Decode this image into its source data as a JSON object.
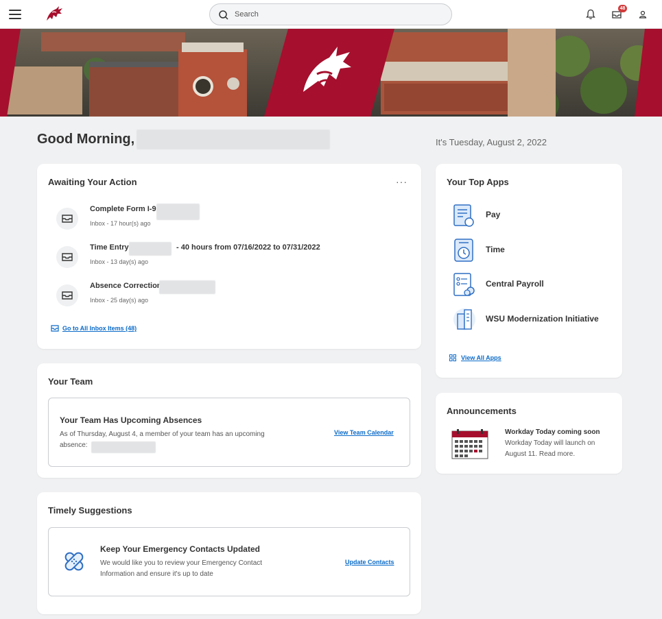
{
  "topbar": {
    "search_placeholder": "Search",
    "inbox_count": "48"
  },
  "greeting": {
    "text": "Good Morning,",
    "date": "It's Tuesday, August 2, 2022"
  },
  "awaiting": {
    "title": "Awaiting Your Action",
    "more": "···",
    "tasks": [
      {
        "title": "Complete Form I-9:",
        "sub": "Inbox - 17 hour(s) ago"
      },
      {
        "title": "Time Entry:",
        "title_suffix": "- 40 hours from 07/16/2022 to 07/31/2022",
        "sub": "Inbox - 13 day(s) ago"
      },
      {
        "title": "Absence Correction:",
        "sub": "Inbox - 25 day(s) ago"
      }
    ],
    "all_link": "Go to All Inbox Items (48)"
  },
  "team": {
    "title": "Your Team",
    "box_title": "Your Team Has Upcoming Absences",
    "box_text_1": "As of Thursday, August 4, a member of your team has an upcoming",
    "box_text_2": "absence:",
    "link": "View Team Calendar"
  },
  "suggestions": {
    "title": "Timely Suggestions",
    "box_title": "Keep Your Emergency Contacts Updated",
    "box_text_1": "We would like you to review your Emergency Contact",
    "box_text_2": "Information and ensure it's up to date",
    "link": "Update Contacts"
  },
  "apps": {
    "title": "Your Top Apps",
    "items": [
      {
        "label": "Pay",
        "icon": "pay-icon"
      },
      {
        "label": "Time",
        "icon": "time-icon"
      },
      {
        "label": "Central Payroll",
        "icon": "central-payroll-icon"
      },
      {
        "label": "WSU Modernization Initiative",
        "icon": "modernization-icon"
      }
    ],
    "view_all": "View All Apps"
  },
  "announcements": {
    "title": "Announcements",
    "item_title": "Workday Today coming soon",
    "item_text_1": "Workday Today will launch on",
    "item_text_2": "August 11. Read more."
  },
  "colors": {
    "brand": "#a60f2d",
    "link": "#0b6bc9",
    "badge": "#d13b3b",
    "app_icon": "#2f6fc4"
  }
}
